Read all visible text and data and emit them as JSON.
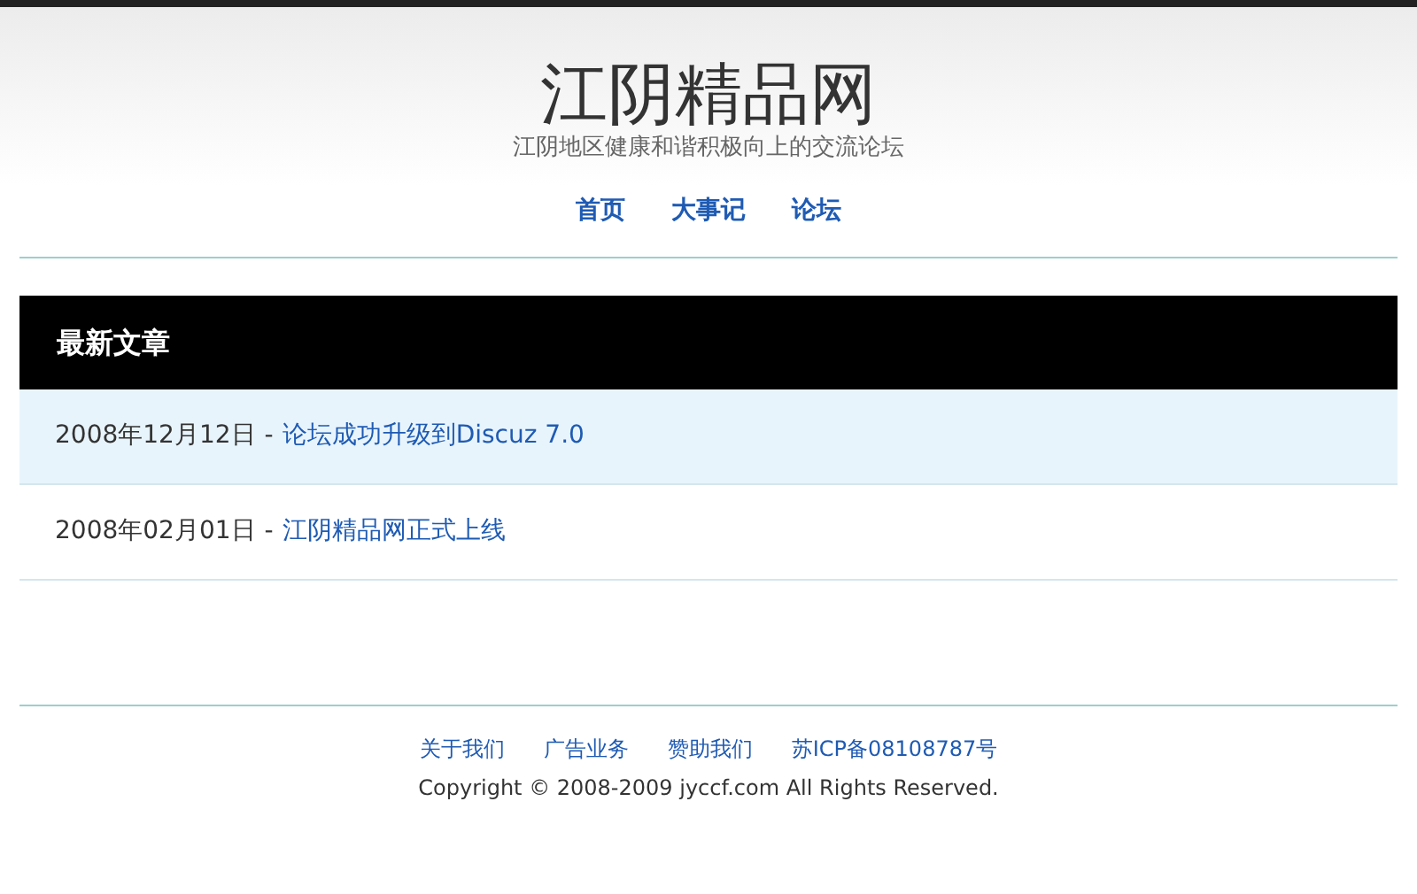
{
  "site": {
    "title": "江阴精品网",
    "tagline": "江阴地区健康和谐积极向上的交流论坛"
  },
  "nav": [
    "首页",
    "大事记",
    "论坛"
  ],
  "articles": {
    "heading": "最新文章",
    "rows": [
      {
        "date": "2008年12月12日",
        "separator": "-",
        "title": "论坛成功升级到Discuz 7.0",
        "highlighted": true
      },
      {
        "date": "2008年02月01日",
        "separator": "-",
        "title": "江阴精品网正式上线",
        "highlighted": false
      }
    ]
  },
  "footer": {
    "links": [
      "关于我们",
      "广告业务",
      "赞助我们",
      "苏ICP备08108787号"
    ],
    "copyright": "Copyright © 2008-2009 jyccf.com All Rights Reserved."
  }
}
